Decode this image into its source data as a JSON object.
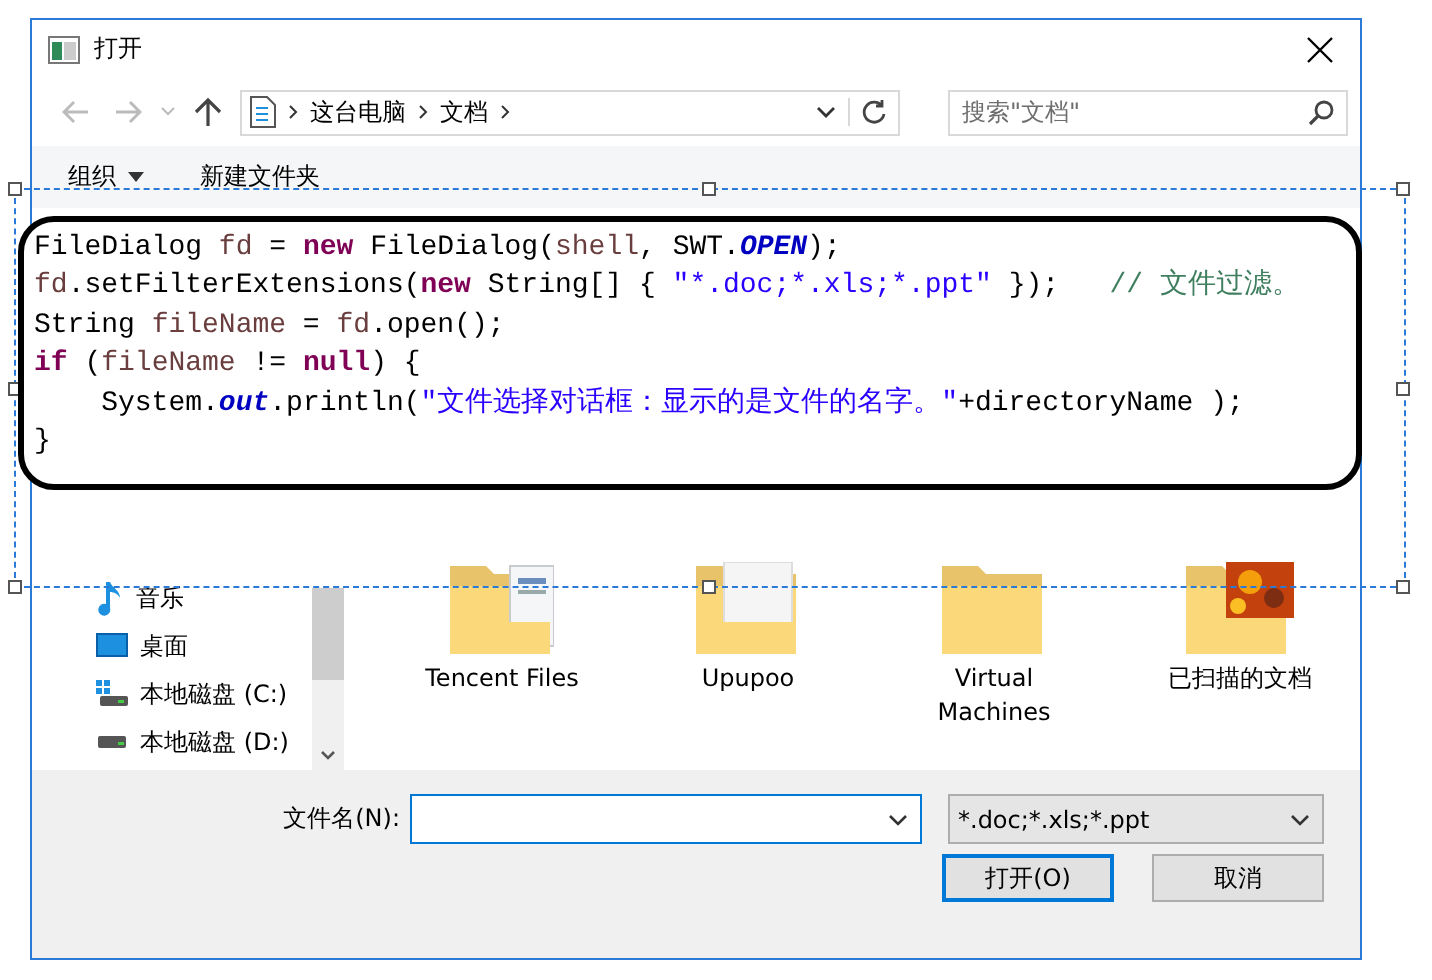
{
  "window": {
    "title": "打开"
  },
  "address": {
    "crumbs": [
      "这台电脑",
      "文档"
    ]
  },
  "search": {
    "placeholder": "搜索\"文档\""
  },
  "toolbar": {
    "items": [
      "组织",
      "新建文件夹"
    ]
  },
  "nav": [
    {
      "label": "音乐",
      "kind": "music"
    },
    {
      "label": "桌面",
      "kind": "desktop"
    },
    {
      "label": "本地磁盘 (C:)",
      "kind": "system-drive"
    },
    {
      "label": "本地磁盘 (D:)",
      "kind": "drive"
    }
  ],
  "folders": [
    {
      "label": "Tencent Files",
      "kind": "docs"
    },
    {
      "label": "Upupoo",
      "kind": "pages"
    },
    {
      "label": "Virtual Machines",
      "kind": "plain"
    },
    {
      "label": "已扫描的文档",
      "kind": "photo"
    }
  ],
  "filename": {
    "label": "文件名(N):"
  },
  "filter": {
    "value": "*.doc;*.xls;*.ppt"
  },
  "buttons": [
    {
      "label": "打开(O)",
      "default": true
    },
    {
      "label": "取消",
      "default": false
    }
  ],
  "code": [
    [
      {
        "text": "FileDialog ",
        "kind": "plain"
      },
      {
        "text": "fd",
        "kind": "var"
      },
      {
        "text": " = ",
        "kind": "plain"
      },
      {
        "text": "new",
        "kind": "kw"
      },
      {
        "text": " FileDialog(",
        "kind": "plain"
      },
      {
        "text": "shell",
        "kind": "var"
      },
      {
        "text": ", SWT.",
        "kind": "plain"
      },
      {
        "text": "OPEN",
        "kind": "const"
      },
      {
        "text": ");",
        "kind": "plain"
      }
    ],
    [
      {
        "text": "fd",
        "kind": "var"
      },
      {
        "text": ".setFilterExtensions(",
        "kind": "plain"
      },
      {
        "text": "new",
        "kind": "kw"
      },
      {
        "text": " String[] { ",
        "kind": "plain"
      },
      {
        "text": "\"*.doc;*.xls;*.ppt\"",
        "kind": "str"
      },
      {
        "text": " });   ",
        "kind": "plain"
      },
      {
        "text": "// 文件过滤。",
        "kind": "comment"
      }
    ],
    [
      {
        "text": "String ",
        "kind": "plain"
      },
      {
        "text": "fileName",
        "kind": "var"
      },
      {
        "text": " = ",
        "kind": "plain"
      },
      {
        "text": "fd",
        "kind": "var"
      },
      {
        "text": ".open();",
        "kind": "plain"
      }
    ],
    [
      {
        "text": "if",
        "kind": "kw"
      },
      {
        "text": " (",
        "kind": "plain"
      },
      {
        "text": "fileName",
        "kind": "var"
      },
      {
        "text": " != ",
        "kind": "plain"
      },
      {
        "text": "null",
        "kind": "kw"
      },
      {
        "text": ") {",
        "kind": "plain"
      }
    ],
    [
      {
        "text": "    System.",
        "kind": "plain"
      },
      {
        "text": "out",
        "kind": "const"
      },
      {
        "text": ".println(",
        "kind": "plain"
      },
      {
        "text": "\"文件选择对话框：显示的是文件的名字。\"",
        "kind": "str"
      },
      {
        "text": "+directoryName );",
        "kind": "plain"
      }
    ],
    [
      {
        "text": "}",
        "kind": "plain"
      }
    ]
  ]
}
